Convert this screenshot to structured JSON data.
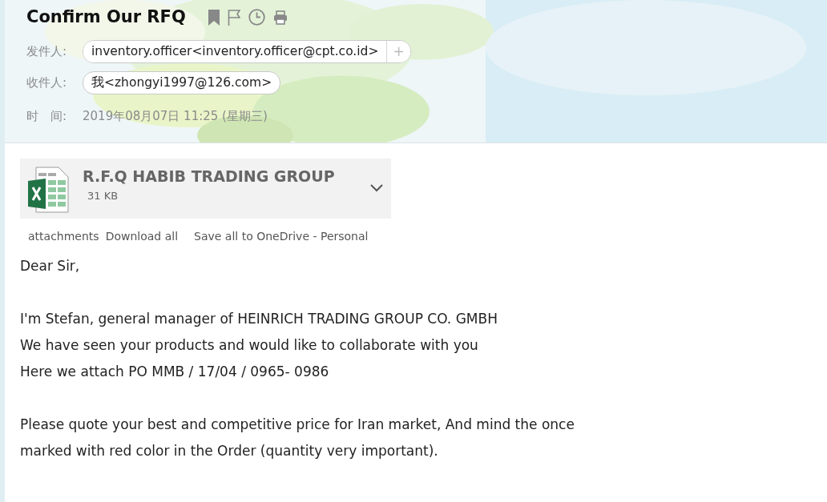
{
  "subject": "Confirm Our RFQ",
  "header_fields": [
    {
      "label": "发件人:",
      "value": "inventory.officer<inventory.officer@cpt.co.id>",
      "add_button": "+"
    },
    {
      "label": "收件人:",
      "value": "我<zhongyi1997@126.com>"
    }
  ],
  "time": {
    "label": "时　间:",
    "value": "2019年08月07日 11:25 (星期三)"
  },
  "attachment": {
    "name": "R.F.Q HABIB TRADING GROUP",
    "size": "31 KB"
  },
  "attachment_links": [
    {
      "text": "attachments",
      "kind": "label"
    },
    {
      "text": "Download all",
      "kind": "link"
    },
    {
      "text": "Save all to OneDrive - Personal",
      "kind": "link"
    }
  ],
  "body": [
    [
      "Dear Sir,"
    ],
    [
      "I'm Stefan, general manager of HEINRICH TRADING GROUP CO. GMBH",
      "We have seen your products and would like to collaborate with you",
      "Here we attach PO MMB / 17/04 / 0965- 0986"
    ],
    [
      "Please quote your best and competitive price for Iran market, And mind the once",
      "marked with red color in the Order (quantity very important)."
    ]
  ]
}
